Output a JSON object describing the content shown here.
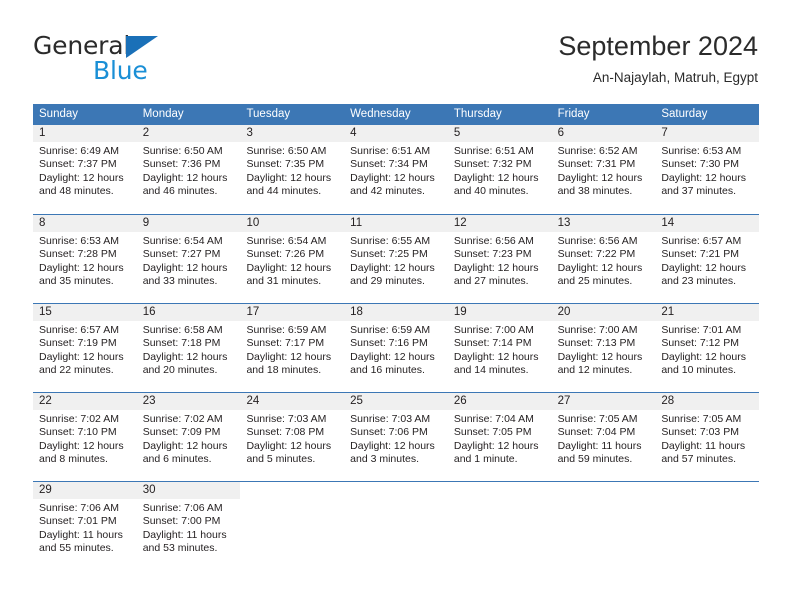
{
  "brand": {
    "name_part1": "General",
    "name_part2": "Blue",
    "flag_icon": "triangle-flag-icon"
  },
  "header": {
    "title": "September 2024",
    "subtitle": "An-Najaylah, Matruh, Egypt"
  },
  "colors": {
    "header_blue": "#3c77b5",
    "brand_blue": "#1a8fd6",
    "brand_flag_blue": "#1a70b8",
    "daynum_band": "#f0f0f0",
    "text": "#231f20"
  },
  "weekdays": [
    "Sunday",
    "Monday",
    "Tuesday",
    "Wednesday",
    "Thursday",
    "Friday",
    "Saturday"
  ],
  "weeks": [
    [
      {
        "day": "1",
        "lines": [
          "Sunrise: 6:49 AM",
          "Sunset: 7:37 PM",
          "Daylight: 12 hours",
          "and 48 minutes."
        ]
      },
      {
        "day": "2",
        "lines": [
          "Sunrise: 6:50 AM",
          "Sunset: 7:36 PM",
          "Daylight: 12 hours",
          "and 46 minutes."
        ]
      },
      {
        "day": "3",
        "lines": [
          "Sunrise: 6:50 AM",
          "Sunset: 7:35 PM",
          "Daylight: 12 hours",
          "and 44 minutes."
        ]
      },
      {
        "day": "4",
        "lines": [
          "Sunrise: 6:51 AM",
          "Sunset: 7:34 PM",
          "Daylight: 12 hours",
          "and 42 minutes."
        ]
      },
      {
        "day": "5",
        "lines": [
          "Sunrise: 6:51 AM",
          "Sunset: 7:32 PM",
          "Daylight: 12 hours",
          "and 40 minutes."
        ]
      },
      {
        "day": "6",
        "lines": [
          "Sunrise: 6:52 AM",
          "Sunset: 7:31 PM",
          "Daylight: 12 hours",
          "and 38 minutes."
        ]
      },
      {
        "day": "7",
        "lines": [
          "Sunrise: 6:53 AM",
          "Sunset: 7:30 PM",
          "Daylight: 12 hours",
          "and 37 minutes."
        ]
      }
    ],
    [
      {
        "day": "8",
        "lines": [
          "Sunrise: 6:53 AM",
          "Sunset: 7:28 PM",
          "Daylight: 12 hours",
          "and 35 minutes."
        ]
      },
      {
        "day": "9",
        "lines": [
          "Sunrise: 6:54 AM",
          "Sunset: 7:27 PM",
          "Daylight: 12 hours",
          "and 33 minutes."
        ]
      },
      {
        "day": "10",
        "lines": [
          "Sunrise: 6:54 AM",
          "Sunset: 7:26 PM",
          "Daylight: 12 hours",
          "and 31 minutes."
        ]
      },
      {
        "day": "11",
        "lines": [
          "Sunrise: 6:55 AM",
          "Sunset: 7:25 PM",
          "Daylight: 12 hours",
          "and 29 minutes."
        ]
      },
      {
        "day": "12",
        "lines": [
          "Sunrise: 6:56 AM",
          "Sunset: 7:23 PM",
          "Daylight: 12 hours",
          "and 27 minutes."
        ]
      },
      {
        "day": "13",
        "lines": [
          "Sunrise: 6:56 AM",
          "Sunset: 7:22 PM",
          "Daylight: 12 hours",
          "and 25 minutes."
        ]
      },
      {
        "day": "14",
        "lines": [
          "Sunrise: 6:57 AM",
          "Sunset: 7:21 PM",
          "Daylight: 12 hours",
          "and 23 minutes."
        ]
      }
    ],
    [
      {
        "day": "15",
        "lines": [
          "Sunrise: 6:57 AM",
          "Sunset: 7:19 PM",
          "Daylight: 12 hours",
          "and 22 minutes."
        ]
      },
      {
        "day": "16",
        "lines": [
          "Sunrise: 6:58 AM",
          "Sunset: 7:18 PM",
          "Daylight: 12 hours",
          "and 20 minutes."
        ]
      },
      {
        "day": "17",
        "lines": [
          "Sunrise: 6:59 AM",
          "Sunset: 7:17 PM",
          "Daylight: 12 hours",
          "and 18 minutes."
        ]
      },
      {
        "day": "18",
        "lines": [
          "Sunrise: 6:59 AM",
          "Sunset: 7:16 PM",
          "Daylight: 12 hours",
          "and 16 minutes."
        ]
      },
      {
        "day": "19",
        "lines": [
          "Sunrise: 7:00 AM",
          "Sunset: 7:14 PM",
          "Daylight: 12 hours",
          "and 14 minutes."
        ]
      },
      {
        "day": "20",
        "lines": [
          "Sunrise: 7:00 AM",
          "Sunset: 7:13 PM",
          "Daylight: 12 hours",
          "and 12 minutes."
        ]
      },
      {
        "day": "21",
        "lines": [
          "Sunrise: 7:01 AM",
          "Sunset: 7:12 PM",
          "Daylight: 12 hours",
          "and 10 minutes."
        ]
      }
    ],
    [
      {
        "day": "22",
        "lines": [
          "Sunrise: 7:02 AM",
          "Sunset: 7:10 PM",
          "Daylight: 12 hours",
          "and 8 minutes."
        ]
      },
      {
        "day": "23",
        "lines": [
          "Sunrise: 7:02 AM",
          "Sunset: 7:09 PM",
          "Daylight: 12 hours",
          "and 6 minutes."
        ]
      },
      {
        "day": "24",
        "lines": [
          "Sunrise: 7:03 AM",
          "Sunset: 7:08 PM",
          "Daylight: 12 hours",
          "and 5 minutes."
        ]
      },
      {
        "day": "25",
        "lines": [
          "Sunrise: 7:03 AM",
          "Sunset: 7:06 PM",
          "Daylight: 12 hours",
          "and 3 minutes."
        ]
      },
      {
        "day": "26",
        "lines": [
          "Sunrise: 7:04 AM",
          "Sunset: 7:05 PM",
          "Daylight: 12 hours",
          "and 1 minute."
        ]
      },
      {
        "day": "27",
        "lines": [
          "Sunrise: 7:05 AM",
          "Sunset: 7:04 PM",
          "Daylight: 11 hours",
          "and 59 minutes."
        ]
      },
      {
        "day": "28",
        "lines": [
          "Sunrise: 7:05 AM",
          "Sunset: 7:03 PM",
          "Daylight: 11 hours",
          "and 57 minutes."
        ]
      }
    ],
    [
      {
        "day": "29",
        "lines": [
          "Sunrise: 7:06 AM",
          "Sunset: 7:01 PM",
          "Daylight: 11 hours",
          "and 55 minutes."
        ]
      },
      {
        "day": "30",
        "lines": [
          "Sunrise: 7:06 AM",
          "Sunset: 7:00 PM",
          "Daylight: 11 hours",
          "and 53 minutes."
        ]
      },
      {
        "day": "",
        "lines": []
      },
      {
        "day": "",
        "lines": []
      },
      {
        "day": "",
        "lines": []
      },
      {
        "day": "",
        "lines": []
      },
      {
        "day": "",
        "lines": []
      }
    ]
  ]
}
